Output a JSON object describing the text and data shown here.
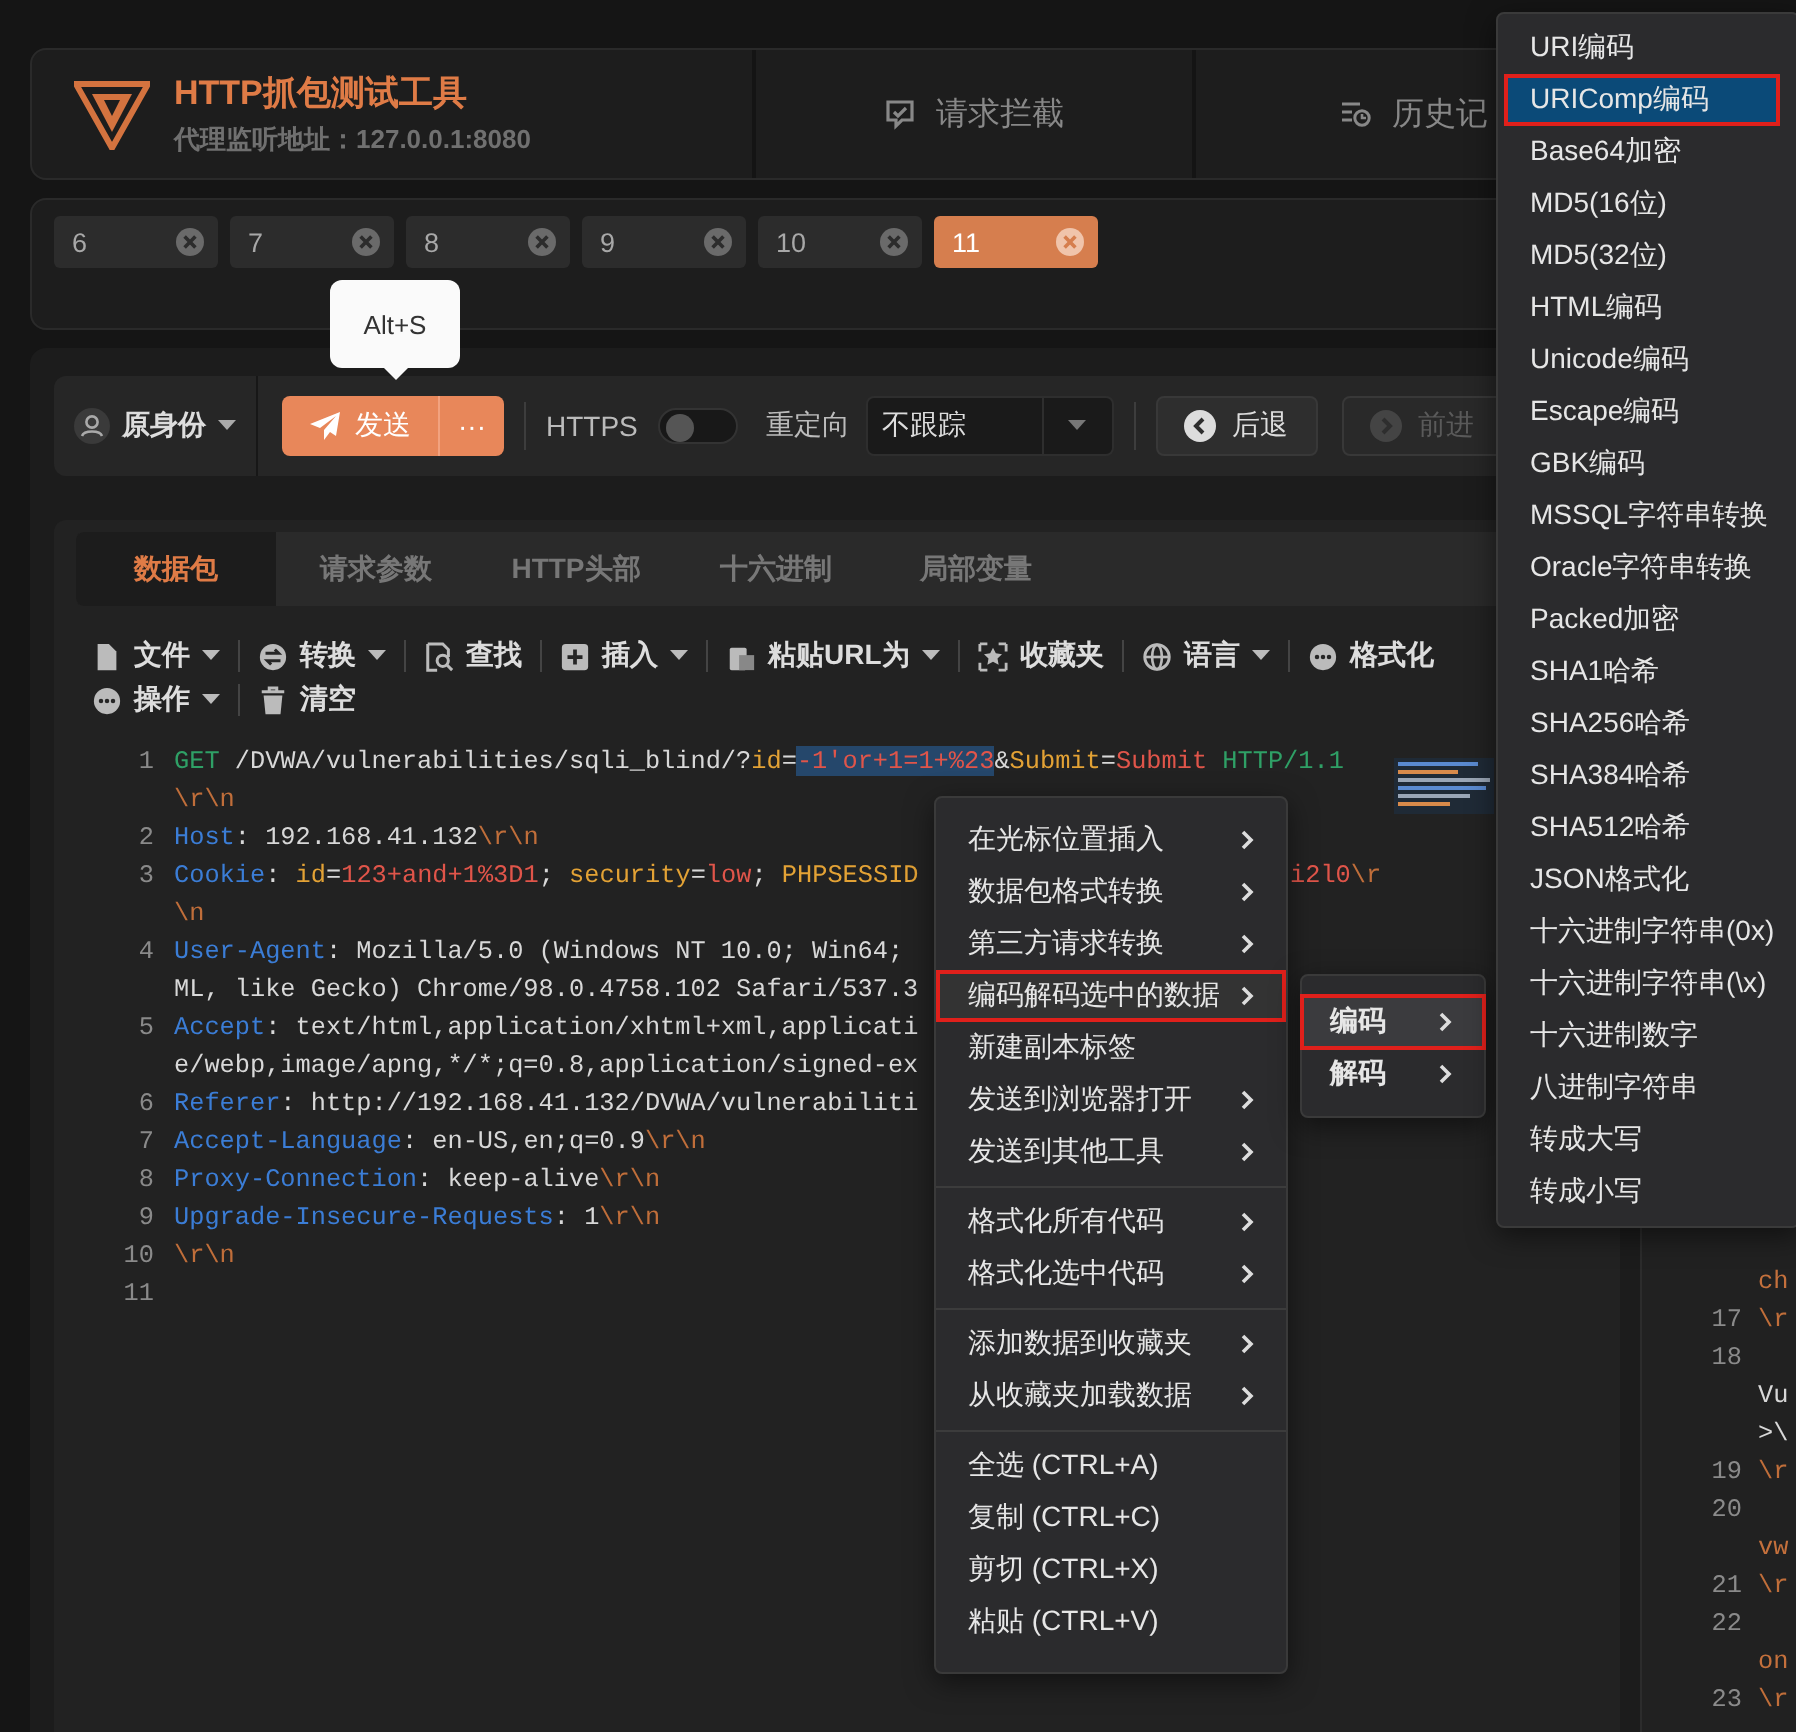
{
  "header": {
    "title": "HTTP抓包测试工具",
    "subtitle": "代理监听地址：127.0.0.1:8080",
    "nav": [
      {
        "label": "请求拦截",
        "kind": "message"
      },
      {
        "label": "历史记",
        "kind": "history"
      }
    ]
  },
  "request_tabs": [
    {
      "label": "6",
      "selected": false
    },
    {
      "label": "7",
      "selected": false
    },
    {
      "label": "8",
      "selected": false
    },
    {
      "label": "9",
      "selected": false
    },
    {
      "label": "10",
      "selected": false
    },
    {
      "label": "11",
      "selected": true
    }
  ],
  "tooltip": "Alt+S",
  "toolbar": {
    "identity": "原身份",
    "send": "发送",
    "more": "···",
    "https_label": "HTTPS",
    "https_on": false,
    "redirect_label": "重定向",
    "redirect_value": "不跟踪",
    "back": {
      "label": "后退",
      "disabled": false
    },
    "forward": {
      "label": "前进",
      "disabled": true
    }
  },
  "editor_tabs": [
    {
      "label": "数据包",
      "selected": true
    },
    {
      "label": "请求参数",
      "selected": false
    },
    {
      "label": "HTTP头部",
      "selected": false
    },
    {
      "label": "十六进制",
      "selected": false
    },
    {
      "label": "局部变量",
      "selected": false
    }
  ],
  "editor_actions": [
    [
      {
        "label": "文件",
        "kind": "file",
        "dropdown": true
      },
      {
        "label": "转换",
        "kind": "swap",
        "dropdown": true
      },
      {
        "label": "查找",
        "kind": "search",
        "dropdown": false
      },
      {
        "label": "插入",
        "kind": "plus",
        "dropdown": true
      },
      {
        "label": "粘贴URL为",
        "kind": "clipboard",
        "dropdown": true
      },
      {
        "label": "收藏夹",
        "kind": "star",
        "dropdown": false
      },
      {
        "label": "语言",
        "kind": "globe",
        "dropdown": true
      },
      {
        "label": "格式化",
        "kind": "dots",
        "dropdown": false
      }
    ],
    [
      {
        "label": "操作",
        "kind": "dots",
        "dropdown": true
      },
      {
        "label": "清空",
        "kind": "trash",
        "dropdown": false
      }
    ]
  ],
  "code_rows": [
    {
      "number": "1",
      "tokens": [
        {
          "kind": "method",
          "text": "GET"
        },
        {
          "kind": "plain",
          "text": " /DVWA/vulnerabilities/sqli_blind/?"
        },
        {
          "kind": "param",
          "text": "id"
        },
        {
          "kind": "plain",
          "text": "="
        },
        {
          "kind": "selected",
          "text": "-1'or+1=1+%23"
        },
        {
          "kind": "plain",
          "text": "&"
        },
        {
          "kind": "param",
          "text": "Submit"
        },
        {
          "kind": "plain",
          "text": "="
        },
        {
          "kind": "value",
          "text": "Submit"
        },
        {
          "kind": "method",
          "text": " HTTP/1.1"
        }
      ]
    },
    {
      "tokens": [
        {
          "kind": "escape",
          "text": "\\r\\n"
        }
      ]
    },
    {
      "number": "2",
      "tokens": [
        {
          "kind": "header",
          "text": "Host"
        },
        {
          "kind": "plain",
          "text": ": 192.168.41.132"
        },
        {
          "kind": "escape",
          "text": "\\r\\n"
        }
      ]
    },
    {
      "number": "3",
      "tokens": [
        {
          "kind": "header",
          "text": "Cookie"
        },
        {
          "kind": "plain",
          "text": ": "
        },
        {
          "kind": "param",
          "text": "id"
        },
        {
          "kind": "plain",
          "text": "="
        },
        {
          "kind": "value",
          "text": "123+and+1%3D1"
        },
        {
          "kind": "plain",
          "text": "; "
        },
        {
          "kind": "param",
          "text": "security"
        },
        {
          "kind": "plain",
          "text": "="
        },
        {
          "kind": "value",
          "text": "low"
        },
        {
          "kind": "plain",
          "text": "; "
        },
        {
          "kind": "param",
          "text": "PHPSESSID"
        }
      ],
      "tail": [
        {
          "kind": "value",
          "text": "i2l0"
        },
        {
          "kind": "escape",
          "text": "\\r"
        }
      ]
    },
    {
      "tokens": [
        {
          "kind": "escape",
          "text": "\\n"
        }
      ]
    },
    {
      "number": "4",
      "tokens": [
        {
          "kind": "header",
          "text": "User-Agent"
        },
        {
          "kind": "plain",
          "text": ": Mozilla/5.0 (Windows NT 10.0; Win64;"
        }
      ]
    },
    {
      "tokens": [
        {
          "kind": "plain",
          "text": "ML, like Gecko) Chrome/98.0.4758.102 Safari/537.3"
        }
      ]
    },
    {
      "number": "5",
      "tokens": [
        {
          "kind": "header",
          "text": "Accept"
        },
        {
          "kind": "plain",
          "text": ": text/html,application/xhtml+xml,applicati"
        }
      ]
    },
    {
      "tokens": [
        {
          "kind": "plain",
          "text": "e/webp,image/apng,*/*;q=0.8,application/signed-ex"
        }
      ]
    },
    {
      "number": "6",
      "tokens": [
        {
          "kind": "header",
          "text": "Referer"
        },
        {
          "kind": "plain",
          "text": ": http://192.168.41.132/DVWA/vulnerabiliti"
        }
      ]
    },
    {
      "number": "7",
      "tokens": [
        {
          "kind": "header",
          "text": "Accept-Language"
        },
        {
          "kind": "plain",
          "text": ": en-US,en;q=0.9"
        },
        {
          "kind": "escape",
          "text": "\\r\\n"
        }
      ]
    },
    {
      "number": "8",
      "tokens": [
        {
          "kind": "header",
          "text": "Proxy-Connection"
        },
        {
          "kind": "plain",
          "text": ": keep-alive"
        },
        {
          "kind": "escape",
          "text": "\\r\\n"
        }
      ]
    },
    {
      "number": "9",
      "tokens": [
        {
          "kind": "header",
          "text": "Upgrade-Insecure-Requests"
        },
        {
          "kind": "plain",
          "text": ": 1"
        },
        {
          "kind": "escape",
          "text": "\\r\\n"
        }
      ]
    },
    {
      "number": "10",
      "tokens": [
        {
          "kind": "escape",
          "text": "\\r\\n"
        }
      ]
    },
    {
      "number": "11",
      "tokens": []
    }
  ],
  "response_rows": [
    {
      "text": "ch",
      "kind": "string"
    },
    {
      "number": "17",
      "text": "\\r",
      "kind": "escape"
    },
    {
      "number": "18"
    },
    {
      "text": "Vu",
      "kind": "plain"
    },
    {
      "text": ">\\",
      "kind": "plain"
    },
    {
      "number": "19",
      "text": "\\r",
      "kind": "escape"
    },
    {
      "number": "20"
    },
    {
      "text": "vw",
      "kind": "string"
    },
    {
      "number": "21",
      "text": "\\r",
      "kind": "escape"
    },
    {
      "number": "22"
    },
    {
      "text": "on",
      "kind": "string"
    },
    {
      "number": "23",
      "text": "\\r",
      "kind": "escape"
    }
  ],
  "context_menu": {
    "groups": [
      [
        {
          "label": "在光标位置插入",
          "submenu": true,
          "selected": false
        },
        {
          "label": "数据包格式转换",
          "submenu": true,
          "selected": false
        },
        {
          "label": "第三方请求转换",
          "submenu": true,
          "selected": false
        },
        {
          "label": "编码解码选中的数据",
          "submenu": true,
          "selected": true
        },
        {
          "label": "新建副本标签",
          "submenu": false,
          "selected": false
        },
        {
          "label": "发送到浏览器打开",
          "submenu": true,
          "selected": false
        },
        {
          "label": "发送到其他工具",
          "submenu": true,
          "selected": false
        }
      ],
      [
        {
          "label": "格式化所有代码",
          "submenu": true,
          "selected": false
        },
        {
          "label": "格式化选中代码",
          "submenu": true,
          "selected": false
        }
      ],
      [
        {
          "label": "添加数据到收藏夹",
          "submenu": true,
          "selected": false
        },
        {
          "label": "从收藏夹加载数据",
          "submenu": true,
          "selected": false
        }
      ],
      [
        {
          "label": "全选 (CTRL+A)",
          "submenu": false,
          "selected": false
        },
        {
          "label": "复制 (CTRL+C)",
          "submenu": false,
          "selected": false
        },
        {
          "label": "剪切 (CTRL+X)",
          "submenu": false,
          "selected": false
        },
        {
          "label": "粘贴 (CTRL+V)",
          "submenu": false,
          "selected": false
        }
      ]
    ]
  },
  "codec_menu": [
    {
      "label": "编码",
      "selected": true
    },
    {
      "label": "解码",
      "selected": false
    }
  ],
  "encode_menu": [
    {
      "label": "URI编码",
      "selected": false
    },
    {
      "label": "URIComp编码",
      "selected": true
    },
    {
      "label": "Base64加密",
      "selected": false
    },
    {
      "label": "MD5(16位)",
      "selected": false
    },
    {
      "label": "MD5(32位)",
      "selected": false
    },
    {
      "label": "HTML编码",
      "selected": false
    },
    {
      "label": "Unicode编码",
      "selected": false
    },
    {
      "label": "Escape编码",
      "selected": false
    },
    {
      "label": "GBK编码",
      "selected": false
    },
    {
      "label": "MSSQL字符串转换",
      "selected": false
    },
    {
      "label": "Oracle字符串转换",
      "selected": false
    },
    {
      "label": "Packed加密",
      "selected": false
    },
    {
      "label": "SHA1哈希",
      "selected": false
    },
    {
      "label": "SHA256哈希",
      "selected": false
    },
    {
      "label": "SHA384哈希",
      "selected": false
    },
    {
      "label": "SHA512哈希",
      "selected": false
    },
    {
      "label": "JSON格式化",
      "selected": false
    },
    {
      "label": "十六进制字符串(0x)",
      "selected": false
    },
    {
      "label": "十六进制字符串(\\x)",
      "selected": false
    },
    {
      "label": "十六进制数字",
      "selected": false
    },
    {
      "label": "八进制字符串",
      "selected": false
    },
    {
      "label": "转成大写",
      "selected": false
    },
    {
      "label": "转成小写",
      "selected": false
    }
  ]
}
